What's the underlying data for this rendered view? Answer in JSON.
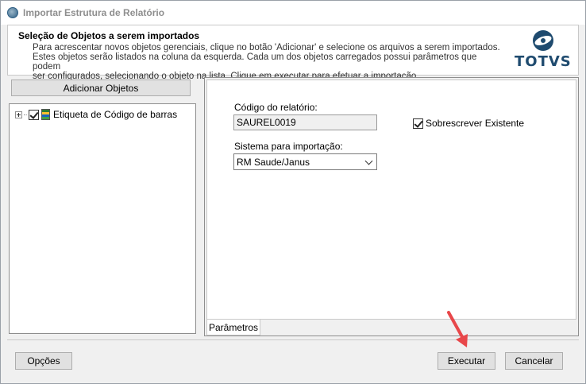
{
  "window": {
    "title": "Importar Estrutura de Relatório"
  },
  "header": {
    "title": "Seleção de Objetos a serem importados",
    "description": "Para acrescentar novos objetos gerenciais, clique no botão 'Adicionar' e selecione os arquivos a serem importados.\nEstes objetos serão listados na coluna da esquerda. Cada um dos objetos carregados possui parâmetros que podem\nser configurados, selecionando o objeto na lista. Clique em executar para efetuar a importação.",
    "logo_text": "TOTVS"
  },
  "left": {
    "add_button": "Adicionar Objetos",
    "tree": [
      {
        "label": "Etiqueta de Código de barras",
        "checked": true
      }
    ]
  },
  "params": {
    "code_label": "Código do relatório:",
    "code_value": "SAUREL0019",
    "system_label": "Sistema para importação:",
    "system_value": "RM Saude/Janus",
    "overwrite_label": "Sobrescrever Existente",
    "overwrite_checked": true,
    "tab_label": "Parâmetros"
  },
  "footer": {
    "options_button": "Opções",
    "execute_button": "Executar",
    "cancel_button": "Cancelar"
  },
  "colors": {
    "logo": "#1f4b6f",
    "arrow": "#e8474a"
  }
}
